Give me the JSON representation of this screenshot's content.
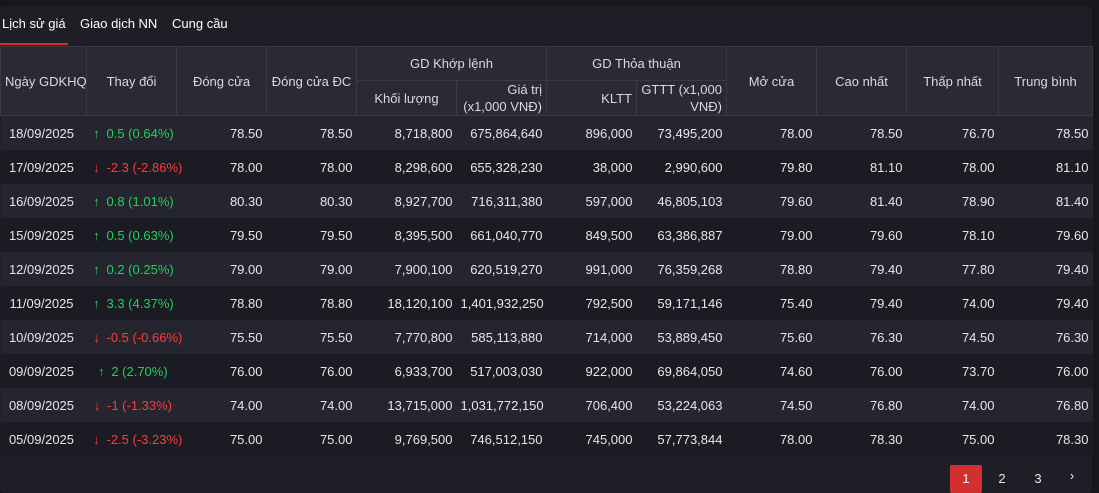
{
  "tabs": [
    {
      "label": "Lịch sử giá",
      "active": true
    },
    {
      "label": "Giao dịch NN",
      "active": false
    },
    {
      "label": "Cung cầu",
      "active": false
    }
  ],
  "headers": {
    "date": "Ngày GDKHQ",
    "change": "Thay đổi",
    "close": "Đóng cửa",
    "adj_close": "Đóng cửa ĐC",
    "matched_group": "GD Khớp lệnh",
    "matched_volume": "Khối lượng",
    "matched_value": "Giá trị (x1,000 VNĐ)",
    "deal_group": "GD Thỏa thuận",
    "deal_volume": "KLTT",
    "deal_value": "GTTT (x1,000 VNĐ)",
    "open": "Mở cửa",
    "high": "Cao nhất",
    "low": "Thấp nhất",
    "avg": "Trung bình"
  },
  "rows": [
    {
      "date": "18/09/2025",
      "dir": "up",
      "change": "0.5 (0.64%)",
      "close": "78.50",
      "adj": "78.50",
      "vol": "8,718,800",
      "val": "675,864,640",
      "kltt": "896,000",
      "gttt": "73,495,200",
      "open": "78.00",
      "high": "78.50",
      "low": "76.70",
      "avg": "78.50"
    },
    {
      "date": "17/09/2025",
      "dir": "down",
      "change": "-2.3 (-2.86%)",
      "close": "78.00",
      "adj": "78.00",
      "vol": "8,298,600",
      "val": "655,328,230",
      "kltt": "38,000",
      "gttt": "2,990,600",
      "open": "79.80",
      "high": "81.10",
      "low": "78.00",
      "avg": "81.10"
    },
    {
      "date": "16/09/2025",
      "dir": "up",
      "change": "0.8 (1.01%)",
      "close": "80.30",
      "adj": "80.30",
      "vol": "8,927,700",
      "val": "716,311,380",
      "kltt": "597,000",
      "gttt": "46,805,103",
      "open": "79.60",
      "high": "81.40",
      "low": "78.90",
      "avg": "81.40"
    },
    {
      "date": "15/09/2025",
      "dir": "up",
      "change": "0.5 (0.63%)",
      "close": "79.50",
      "adj": "79.50",
      "vol": "8,395,500",
      "val": "661,040,770",
      "kltt": "849,500",
      "gttt": "63,386,887",
      "open": "79.00",
      "high": "79.60",
      "low": "78.10",
      "avg": "79.60"
    },
    {
      "date": "12/09/2025",
      "dir": "up",
      "change": "0.2 (0.25%)",
      "close": "79.00",
      "adj": "79.00",
      "vol": "7,900,100",
      "val": "620,519,270",
      "kltt": "991,000",
      "gttt": "76,359,268",
      "open": "78.80",
      "high": "79.40",
      "low": "77.80",
      "avg": "79.40"
    },
    {
      "date": "11/09/2025",
      "dir": "up",
      "change": "3.3 (4.37%)",
      "close": "78.80",
      "adj": "78.80",
      "vol": "18,120,100",
      "val": "1,401,932,250",
      "kltt": "792,500",
      "gttt": "59,171,146",
      "open": "75.40",
      "high": "79.40",
      "low": "74.00",
      "avg": "79.40"
    },
    {
      "date": "10/09/2025",
      "dir": "down",
      "change": "-0.5 (-0.66%)",
      "close": "75.50",
      "adj": "75.50",
      "vol": "7,770,800",
      "val": "585,113,880",
      "kltt": "714,000",
      "gttt": "53,889,450",
      "open": "75.60",
      "high": "76.30",
      "low": "74.50",
      "avg": "76.30"
    },
    {
      "date": "09/09/2025",
      "dir": "up",
      "change": "2 (2.70%)",
      "close": "76.00",
      "adj": "76.00",
      "vol": "6,933,700",
      "val": "517,003,030",
      "kltt": "922,000",
      "gttt": "69,864,050",
      "open": "74.60",
      "high": "76.00",
      "low": "73.70",
      "avg": "76.00"
    },
    {
      "date": "08/09/2025",
      "dir": "down",
      "change": "-1 (-1.33%)",
      "close": "74.00",
      "adj": "74.00",
      "vol": "13,715,000",
      "val": "1,031,772,150",
      "kltt": "706,400",
      "gttt": "53,224,063",
      "open": "74.50",
      "high": "76.80",
      "low": "74.00",
      "avg": "76.80"
    },
    {
      "date": "05/09/2025",
      "dir": "down",
      "change": "-2.5 (-3.23%)",
      "close": "75.00",
      "adj": "75.00",
      "vol": "9,769,500",
      "val": "746,512,150",
      "kltt": "745,000",
      "gttt": "57,773,844",
      "open": "78.00",
      "high": "78.30",
      "low": "75.00",
      "avg": "78.30"
    }
  ],
  "pagination": {
    "pages": [
      "1",
      "2",
      "3"
    ],
    "current": "1",
    "next_icon": "›"
  },
  "colors": {
    "up": "#1fd15a",
    "down": "#ff3b3b",
    "accent": "#d32f2f"
  },
  "icons": {
    "up": "arrow-up-icon",
    "down": "arrow-down-icon"
  }
}
